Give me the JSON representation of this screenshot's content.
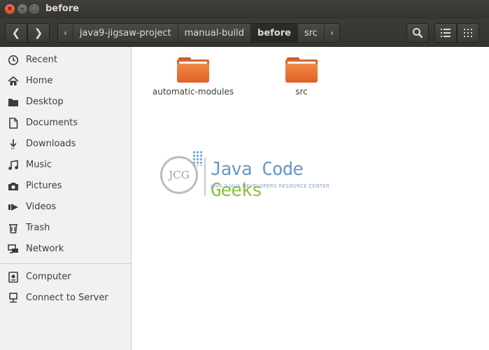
{
  "window": {
    "title": "before"
  },
  "toolbar": {
    "back_glyph": "❮",
    "forward_glyph": "❯",
    "breadcrumb": [
      {
        "label": "‹",
        "kind": "arrow"
      },
      {
        "label": "java9-jigsaw-project"
      },
      {
        "label": "manual-build"
      },
      {
        "label": "before",
        "active": true
      },
      {
        "label": "src"
      },
      {
        "label": "›",
        "kind": "arrow"
      }
    ]
  },
  "sidebar": {
    "items": [
      {
        "label": "Recent",
        "icon": "clock-icon"
      },
      {
        "label": "Home",
        "icon": "home-icon"
      },
      {
        "label": "Desktop",
        "icon": "desktop-folder-icon"
      },
      {
        "label": "Documents",
        "icon": "document-icon"
      },
      {
        "label": "Downloads",
        "icon": "download-icon"
      },
      {
        "label": "Music",
        "icon": "music-icon"
      },
      {
        "label": "Pictures",
        "icon": "camera-icon"
      },
      {
        "label": "Videos",
        "icon": "video-icon"
      },
      {
        "label": "Trash",
        "icon": "trash-icon"
      },
      {
        "label": "Network",
        "icon": "network-icon"
      }
    ],
    "devices": [
      {
        "label": "Computer",
        "icon": "computer-icon"
      },
      {
        "label": "Connect to Server",
        "icon": "server-icon"
      }
    ]
  },
  "files": [
    {
      "name": "automatic-modules",
      "type": "folder"
    },
    {
      "name": "src",
      "type": "folder"
    }
  ],
  "watermark": {
    "logo_text": "JCG",
    "title_part1": "Java Code ",
    "title_part2": "Geeks",
    "subtitle": "JAVA 2 JAVA DEVELOPERS RESOURCE CENTER"
  },
  "colors": {
    "folder_orange": "#e8703a",
    "titlebar": "#3c3b37",
    "close_button": "#e95420"
  }
}
